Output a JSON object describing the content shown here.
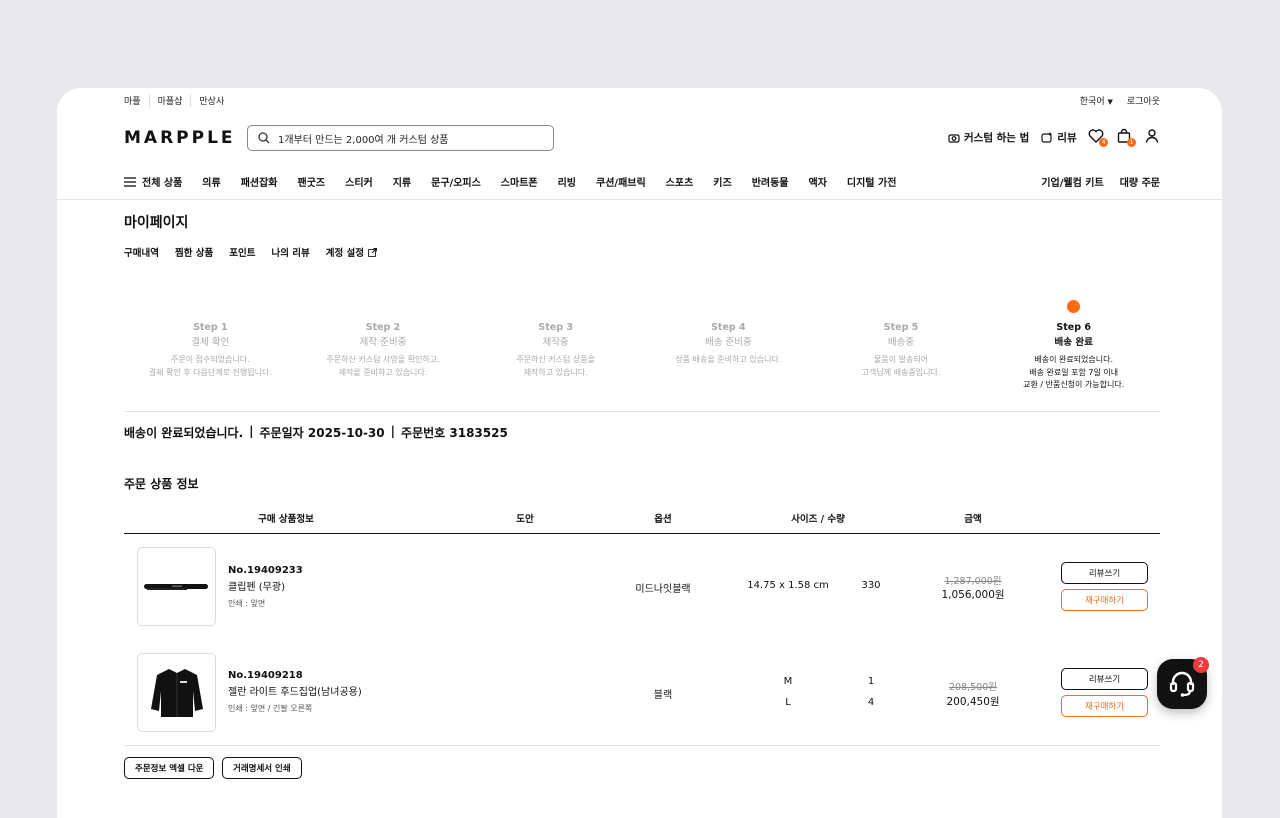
{
  "topbar": {
    "links": [
      "마플",
      "마플샵",
      "만상사"
    ],
    "language": "한국어",
    "logout": "로그아웃"
  },
  "header": {
    "logo": "MARPPLE",
    "search_placeholder": "1개부터 만드는 2,000여 개 커스텀 상품",
    "how_to": "커스텀 하는 법",
    "review": "리뷰",
    "wishlist_count": "4",
    "cart_count": "1"
  },
  "nav": {
    "all": "전체 상품",
    "items": [
      "의류",
      "패션잡화",
      "팬굿즈",
      "스티커",
      "지류",
      "문구/오피스",
      "스마트폰",
      "리빙",
      "쿠션/패브릭",
      "스포츠",
      "키즈",
      "반려동물",
      "액자",
      "디지털 가전"
    ],
    "right": [
      "기업/웰컴 키트",
      "대량 주문"
    ]
  },
  "page": {
    "title": "마이페이지",
    "tabs": [
      "구매내역",
      "찜한 상품",
      "포인트",
      "나의 리뷰",
      "계정 설정"
    ]
  },
  "steps": [
    {
      "step": "Step 1",
      "name": "결제 확인",
      "desc": [
        "주문이 접수되었습니다.",
        "결제 확인 후 다음단계로 진행됩니다."
      ]
    },
    {
      "step": "Step 2",
      "name": "제작 준비중",
      "desc": [
        "주문하신 커스텀 사양을 확인하고,",
        "제작을 준비하고 있습니다."
      ]
    },
    {
      "step": "Step 3",
      "name": "제작중",
      "desc": [
        "주문하신 커스텀 상품을",
        "제작하고 있습니다."
      ]
    },
    {
      "step": "Step 4",
      "name": "배송 준비중",
      "desc": [
        "상품 배송을 준비하고 있습니다."
      ]
    },
    {
      "step": "Step 5",
      "name": "배송중",
      "desc": [
        "물품이 발송되어",
        "고객님께 배송중입니다."
      ]
    },
    {
      "step": "Step 6",
      "name": "배송 완료",
      "desc": [
        "배송이 완료되었습니다.",
        "배송 완료일 포함 7일 이내",
        "교환 / 반품신청이 가능합니다."
      ],
      "active": true
    }
  ],
  "order": {
    "status": "배송이 완료되었습니다.",
    "date_label": "주문일자 2025-10-30",
    "number_label": "주문번호 3183525"
  },
  "section_title": "주문 상품 정보",
  "table_headers": [
    "구매 상품정보",
    "도안",
    "옵션",
    "사이즈 / 수량",
    "금액"
  ],
  "products": [
    {
      "no": "No.19409233",
      "name": "클립펜 (무광)",
      "print": "인쇄 : 앞면",
      "option": "미드나잇블랙",
      "sizes": [
        {
          "size": "14.75 x 1.58 cm",
          "qty": "330"
        }
      ],
      "original_price": "1,287,000원",
      "price": "1,056,000원"
    },
    {
      "no": "No.19409218",
      "name": "젤란 라이트 후드집업(남녀공용)",
      "print": "인쇄 : 앞면 / 긴팔 오른쪽",
      "option": "블랙",
      "sizes": [
        {
          "size": "M",
          "qty": "1"
        },
        {
          "size": "L",
          "qty": "4"
        }
      ],
      "original_price": "208,500원",
      "price": "200,450원"
    }
  ],
  "buttons": {
    "review": "리뷰쓰기",
    "reorder": "재구매하기",
    "excel": "주문정보 엑셀 다운",
    "receipt": "거래명세서 인쇄"
  },
  "support_badge": "2",
  "colors": {
    "accent": "#ff6a13",
    "badge_red": "#f23a3a"
  }
}
